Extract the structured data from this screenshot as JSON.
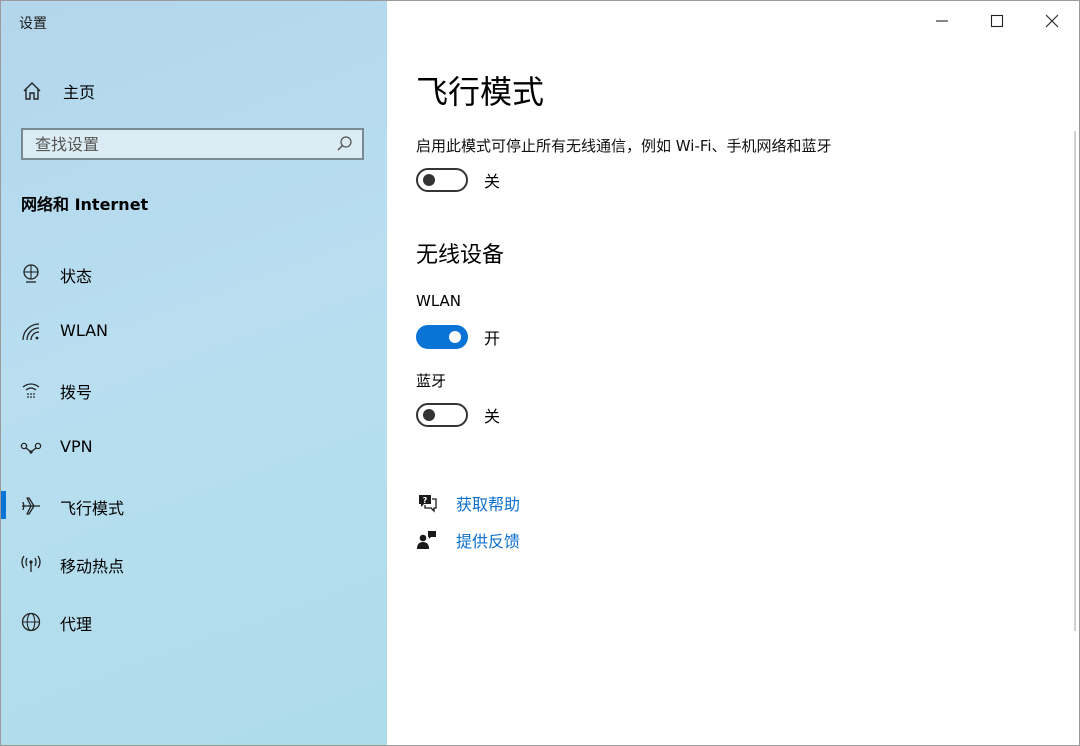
{
  "window": {
    "title": "设置"
  },
  "sidebar": {
    "home": {
      "label": "主页",
      "icon": "home-icon"
    },
    "search": {
      "placeholder": "查找设置",
      "icon": "search-icon"
    },
    "section_title": "网络和 Internet",
    "items": [
      {
        "label": "状态",
        "icon": "globe-status-icon",
        "active": false
      },
      {
        "label": "WLAN",
        "icon": "wifi-icon",
        "active": false
      },
      {
        "label": "拨号",
        "icon": "dialup-icon",
        "active": false
      },
      {
        "label": "VPN",
        "icon": "vpn-icon",
        "active": false
      },
      {
        "label": "飞行模式",
        "icon": "airplane-icon",
        "active": true
      },
      {
        "label": "移动热点",
        "icon": "hotspot-icon",
        "active": false
      },
      {
        "label": "代理",
        "icon": "globe-icon",
        "active": false
      }
    ],
    "accent": "#0a74d6"
  },
  "main": {
    "title": "飞行模式",
    "description": "启用此模式可停止所有无线通信，例如 Wi-Fi、手机网络和蓝牙",
    "airplane_toggle": {
      "state": "off",
      "text": "关"
    },
    "wireless_title": "无线设备",
    "wlan": {
      "label": "WLAN",
      "state": "on",
      "text": "开"
    },
    "bluetooth": {
      "label": "蓝牙",
      "state": "off",
      "text": "关"
    },
    "links": [
      {
        "label": "获取帮助",
        "icon": "help-chat-icon"
      },
      {
        "label": "提供反馈",
        "icon": "feedback-icon"
      }
    ],
    "link_color": "#0a6fce"
  }
}
